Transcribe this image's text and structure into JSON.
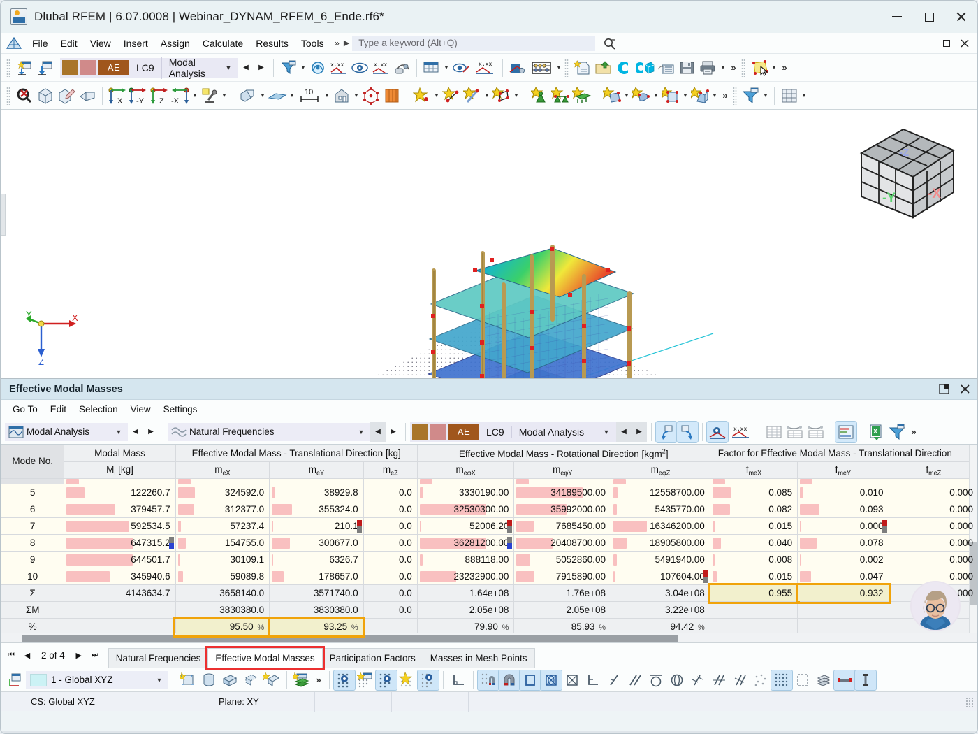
{
  "window": {
    "title": "Dlubal RFEM | 6.07.0008 | Webinar_DYNAM_RFEM_6_Ende.rf6*",
    "minimize_label": "Minimize",
    "maximize_label": "Maximize",
    "close_label": "Close"
  },
  "menubar": {
    "items": [
      "File",
      "Edit",
      "View",
      "Insert",
      "Assign",
      "Calculate",
      "Results",
      "Tools"
    ],
    "overflow": "»",
    "play": "▶",
    "search_placeholder": "Type a keyword (Alt+Q)"
  },
  "toolbar_main": {
    "load_case_id": "LC9",
    "load_case_name": "Modal Analysis",
    "ae_badge": "AE",
    "swatch1": "#a9752a",
    "swatch2": "#d08a8a",
    "ae_color": "#a0561c",
    "overflow": "»"
  },
  "viewport": {
    "axis_x": "X",
    "axis_y": "Y",
    "axis_z": "Z",
    "cube_face_left": "-Y",
    "cube_face_right": "-X",
    "cube_face_top": "-Z",
    "model_x_marker": "X",
    "model_y_marker": "Y"
  },
  "panel": {
    "title": "Effective Modal Masses",
    "menu": [
      "Go To",
      "Edit",
      "Selection",
      "View",
      "Settings"
    ],
    "combo_analysis": "Modal Analysis",
    "combo_result": "Natural Frequencies",
    "combo_case_id": "LC9",
    "combo_case_name": "Modal Analysis",
    "overflow": "»"
  },
  "chart_data": {
    "type": "table",
    "title": "Effective Modal Masses",
    "column_groups": [
      {
        "label": "Mode No.",
        "span": 1
      },
      {
        "label": "Modal Mass",
        "span": 1
      },
      {
        "label": "Effective Modal Mass - Translational Direction [kg]",
        "span": 3
      },
      {
        "label": "Effective Modal Mass - Rotational Direction [kgm2]",
        "span": 3
      },
      {
        "label": "Factor for Effective Modal Mass - Translational Direction",
        "span": 3
      }
    ],
    "columns": [
      "Mode No.",
      "Mi [kg]",
      "meX",
      "meY",
      "meZ",
      "meφX",
      "meφY",
      "meφZ",
      "fmeX",
      "fmeY",
      "fmeZ"
    ],
    "rows": [
      {
        "mode": "5",
        "modal_mass": "122260.7",
        "meX": "324592.0",
        "meY": "38929.8",
        "meZ": "0.0",
        "mephX": "3330190.00",
        "mephY": "34189500.00",
        "mephZ": "12558700.00",
        "fmeX": "0.085",
        "fmeY": "0.010",
        "fmeZ": "0.000",
        "bars": {
          "modal_mass": 26,
          "meX": 24,
          "meY": 5,
          "mephX": 5,
          "mephY": 95,
          "mephZ": 6
        },
        "bars2": {
          "fmeX": 26,
          "fmeY": 5
        }
      },
      {
        "mode": "6",
        "modal_mass": "379457.7",
        "meX": "312377.0",
        "meY": "355324.0",
        "meZ": "0.0",
        "mephX": "32530300.00",
        "mephY": "35992000.00",
        "mephZ": "5435770.00",
        "fmeX": "0.082",
        "fmeY": "0.093",
        "fmeZ": "0.000",
        "bars": {
          "modal_mass": 70,
          "meX": 23,
          "meY": 29,
          "mephX": 95,
          "mephY": 72,
          "mephZ": 5
        },
        "bars2": {
          "fmeX": 25,
          "fmeY": 28
        }
      },
      {
        "mode": "7",
        "modal_mass": "592534.5",
        "meX": "57237.4",
        "meY": "210.1",
        "meZ": "0.0",
        "mephX": "52006.20",
        "mephY": "7685450.00",
        "mephZ": "16346200.00",
        "fmeX": "0.015",
        "fmeY": "0.000",
        "fmeZ": "0.000",
        "bars": {
          "modal_mass": 90,
          "meX": 4,
          "meY": 2,
          "mephX": 2,
          "mephY": 25,
          "mephZ": 48
        },
        "bars2": {
          "fmeX": 4,
          "fmeY": 2
        }
      },
      {
        "mode": "8",
        "modal_mass": "647315.2",
        "meX": "154755.0",
        "meY": "300677.0",
        "meZ": "0.0",
        "mephX": "36281200.00",
        "mephY": "20408700.00",
        "mephZ": "18905800.00",
        "fmeX": "0.040",
        "fmeY": "0.078",
        "fmeZ": "0.000",
        "bars": {
          "modal_mass": 96,
          "meX": 11,
          "meY": 26,
          "mephX": 95,
          "mephY": 52,
          "mephZ": 19
        },
        "bars2": {
          "fmeX": 12,
          "fmeY": 24
        }
      },
      {
        "mode": "9",
        "modal_mass": "644501.7",
        "meX": "30109.1",
        "meY": "6326.7",
        "meZ": "0.0",
        "mephX": "888118.00",
        "mephY": "5052860.00",
        "mephZ": "5491940.00",
        "fmeX": "0.008",
        "fmeY": "0.002",
        "fmeZ": "0.000",
        "bars": {
          "modal_mass": 95,
          "meX": 3,
          "meY": 2,
          "mephX": 4,
          "mephY": 20,
          "mephZ": 5
        },
        "bars2": {
          "fmeX": 3,
          "fmeY": 2
        }
      },
      {
        "mode": "10",
        "modal_mass": "345940.6",
        "meX": "59089.8",
        "meY": "178657.0",
        "meZ": "0.0",
        "mephX": "23232900.00",
        "mephY": "7915890.00",
        "mephZ": "107604.00",
        "fmeX": "0.015",
        "fmeY": "0.047",
        "fmeZ": "0.000",
        "bars": {
          "modal_mass": 62,
          "meX": 7,
          "meY": 17,
          "mephX": 52,
          "mephY": 26,
          "mephZ": 2
        },
        "bars2": {
          "fmeX": 6,
          "fmeY": 16
        }
      }
    ],
    "summary_rows": [
      {
        "label": "Σ",
        "modal_mass": "4143634.7",
        "meX": "3658140.0",
        "meY": "3571740.0",
        "meZ": "0.0",
        "mephX": "1.64e+08",
        "mephY": "1.76e+08",
        "mephZ": "3.04e+08",
        "fmeX": "0.955",
        "fmeY": "0.932",
        "fmeZ": "0.000",
        "highlight": [
          "fmeX",
          "fmeY"
        ]
      },
      {
        "label": "ΣM",
        "modal_mass": "",
        "meX": "3830380.0",
        "meY": "3830380.0",
        "meZ": "0.0",
        "mephX": "2.05e+08",
        "mephY": "2.05e+08",
        "mephZ": "3.22e+08",
        "fmeX": "",
        "fmeY": "",
        "fmeZ": "",
        "highlight": []
      },
      {
        "label": "%",
        "modal_mass": "",
        "meX": "95.50 %",
        "meY": "93.25 %",
        "meZ": "",
        "mephX": "79.90 %",
        "mephY": "85.93 %",
        "mephZ": "94.42 %",
        "fmeX": "",
        "fmeY": "",
        "fmeZ": "",
        "highlight": [
          "meX",
          "meY"
        ]
      }
    ],
    "highlight_color": "#f0a30a",
    "bar_color": "#f9c0c0"
  },
  "tabs": {
    "pager_first": "⏮",
    "pager_prev": "◀",
    "pager_label": "2 of 4",
    "pager_next": "▶",
    "pager_last": "⏭",
    "items": [
      {
        "label": "Natural Frequencies",
        "active": false,
        "marked": false
      },
      {
        "label": "Effective Modal Masses",
        "active": true,
        "marked": true
      },
      {
        "label": "Participation Factors",
        "active": false,
        "marked": false
      },
      {
        "label": "Masses in Mesh Points",
        "active": false,
        "marked": false
      }
    ],
    "marker_color": "#ec3030"
  },
  "bottom_toolbar": {
    "cs_value": "1 - Global XYZ",
    "overflow": "»"
  },
  "statusbar": {
    "cs": "CS: Global XYZ",
    "plane": "Plane: XY"
  }
}
